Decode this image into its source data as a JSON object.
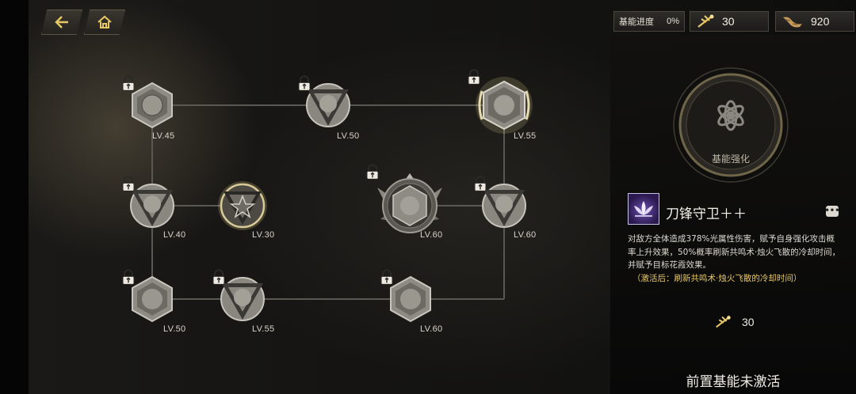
{
  "nav": {
    "back_icon": "back-arrow-icon",
    "home_icon": "home-icon"
  },
  "topbar": {
    "progress_label": "基能进度",
    "progress_value": "0%",
    "currency_primary": {
      "icon": "feather-quill-icon",
      "value": "30"
    },
    "currency_secondary": {
      "icon": "bird-feather-icon",
      "value": "920"
    }
  },
  "tree": {
    "nodes": [
      {
        "id": "n1",
        "level": "LV.45"
      },
      {
        "id": "n2",
        "level": "LV.50"
      },
      {
        "id": "n3",
        "level": "LV.55"
      },
      {
        "id": "n4",
        "level": "LV.40"
      },
      {
        "id": "n5",
        "level": "LV.30"
      },
      {
        "id": "n6",
        "level": "LV.60"
      },
      {
        "id": "n7",
        "level": "LV.60"
      },
      {
        "id": "n8",
        "level": "LV.50"
      },
      {
        "id": "n9",
        "level": "LV.55"
      },
      {
        "id": "n10",
        "level": "LV.60"
      }
    ]
  },
  "detail": {
    "emblem_label": "基能强化",
    "skill_name": "刀锋守卫＋＋",
    "more_label": "•••",
    "description": "对敌方全体造成378%光属性伤害，赋予自身强化攻击概率上升效果，50%概率刷新共鸣术·烛火飞散的冷却时间，并赋予目标花霞效果。",
    "after_activation": "（激活后：刷新共鸣术·烛火飞散的冷却时间）",
    "cost_value": "30",
    "status": "前置基能未激活"
  },
  "colors": {
    "accent_gold": "#e8c864",
    "node_silver": "#b9b6ae"
  }
}
